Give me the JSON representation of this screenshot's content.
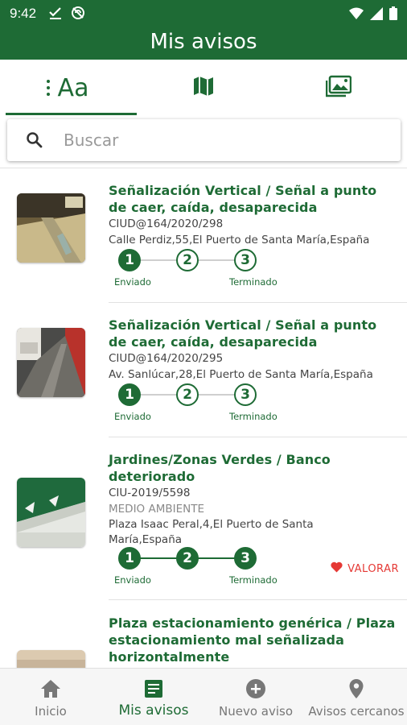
{
  "status_bar": {
    "time": "9:42"
  },
  "app_bar": {
    "title": "Mis avisos"
  },
  "tabs": [
    {
      "label": "Aa",
      "icon": "text-list-icon",
      "selected": true
    },
    {
      "label": "",
      "icon": "map-icon",
      "selected": false
    },
    {
      "label": "",
      "icon": "gallery-icon",
      "selected": false
    }
  ],
  "search": {
    "placeholder": "Buscar",
    "value": ""
  },
  "colors": {
    "primary": "#1e6b35",
    "accent_red": "#e53935"
  },
  "notices": [
    {
      "title": "Señalización Vertical / Señal a punto de caer, caída, desaparecida",
      "code": "CIUD@164/2020/298",
      "category": "",
      "address": "Calle Perdiz,55,El Puerto de Santa María,España",
      "steps": [
        "1",
        "2",
        "3"
      ],
      "current_step": 1,
      "step_labels": {
        "first": "Enviado",
        "last": "Terminado"
      },
      "rate_label": ""
    },
    {
      "title": "Señalización Vertical / Señal a punto de caer, caída, desaparecida",
      "code": "CIUD@164/2020/295",
      "category": "",
      "address": "Av. Sanlúcar,28,El Puerto de Santa María,España",
      "steps": [
        "1",
        "2",
        "3"
      ],
      "current_step": 1,
      "step_labels": {
        "first": "Enviado",
        "last": "Terminado"
      },
      "rate_label": ""
    },
    {
      "title": "Jardines/Zonas Verdes / Banco deteriorado",
      "code": "CIU-2019/5598",
      "category": "MEDIO AMBIENTE",
      "address": "Plaza Isaac Peral,4,El Puerto de Santa María,España",
      "steps": [
        "1",
        "2",
        "3"
      ],
      "current_step": 3,
      "step_labels": {
        "first": "Enviado",
        "last": "Terminado"
      },
      "rate_label": "VALORAR"
    },
    {
      "title": "Plaza estacionamiento genérica / Plaza estacionamiento mal señalizada horizontalmente"
    }
  ],
  "bottom_nav": [
    {
      "label": "Inicio",
      "icon": "home-icon",
      "active": false
    },
    {
      "label": "Mis avisos",
      "icon": "list-doc-icon",
      "active": true
    },
    {
      "label": "Nuevo aviso",
      "icon": "add-circle-icon",
      "active": false
    },
    {
      "label": "Avisos cercanos",
      "icon": "location-pin-icon",
      "active": false
    }
  ]
}
